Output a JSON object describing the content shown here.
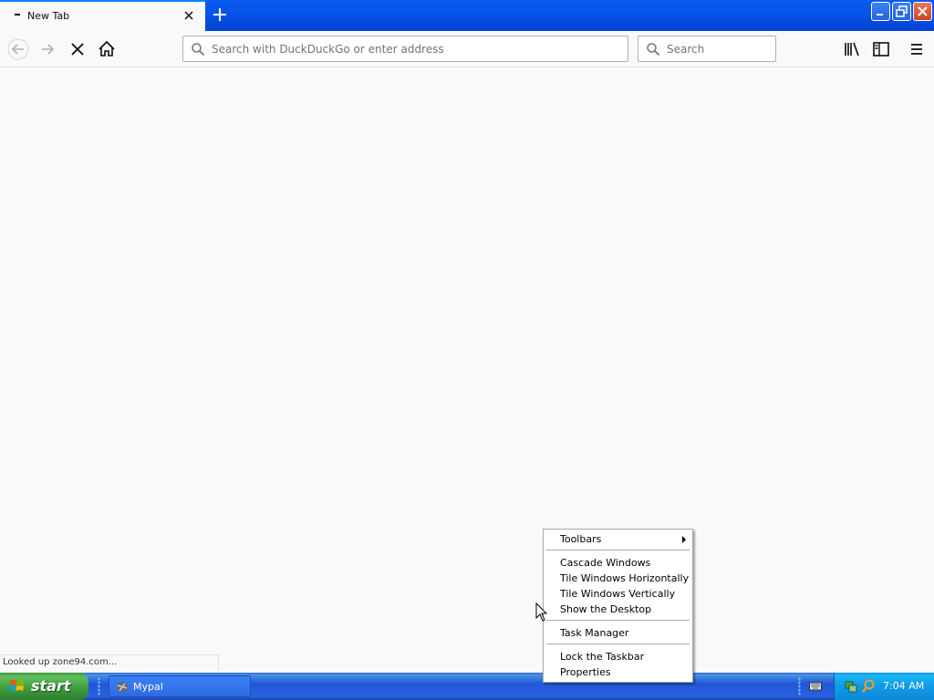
{
  "browser": {
    "tab_title": "New Tab",
    "url_placeholder": "Search with DuckDuckGo or enter address",
    "search_placeholder": "Search",
    "status_text": "Looked up zone94.com..."
  },
  "context_menu": {
    "items": [
      {
        "label": "Toolbars",
        "submenu": true
      },
      {
        "label": "Cascade Windows"
      },
      {
        "label": "Tile Windows Horizontally"
      },
      {
        "label": "Tile Windows Vertically"
      },
      {
        "label": "Show the Desktop"
      },
      {
        "label": "Task Manager"
      },
      {
        "label": "Lock the Taskbar"
      },
      {
        "label": "Properties"
      }
    ]
  },
  "taskbar": {
    "start_label": "start",
    "task_label": "Mypal",
    "clock": "7:04 AM"
  },
  "colors": {
    "taskbar_blue": "#2157d7",
    "start_green": "#3d9a3d",
    "tray_blue": "#1099e8"
  }
}
